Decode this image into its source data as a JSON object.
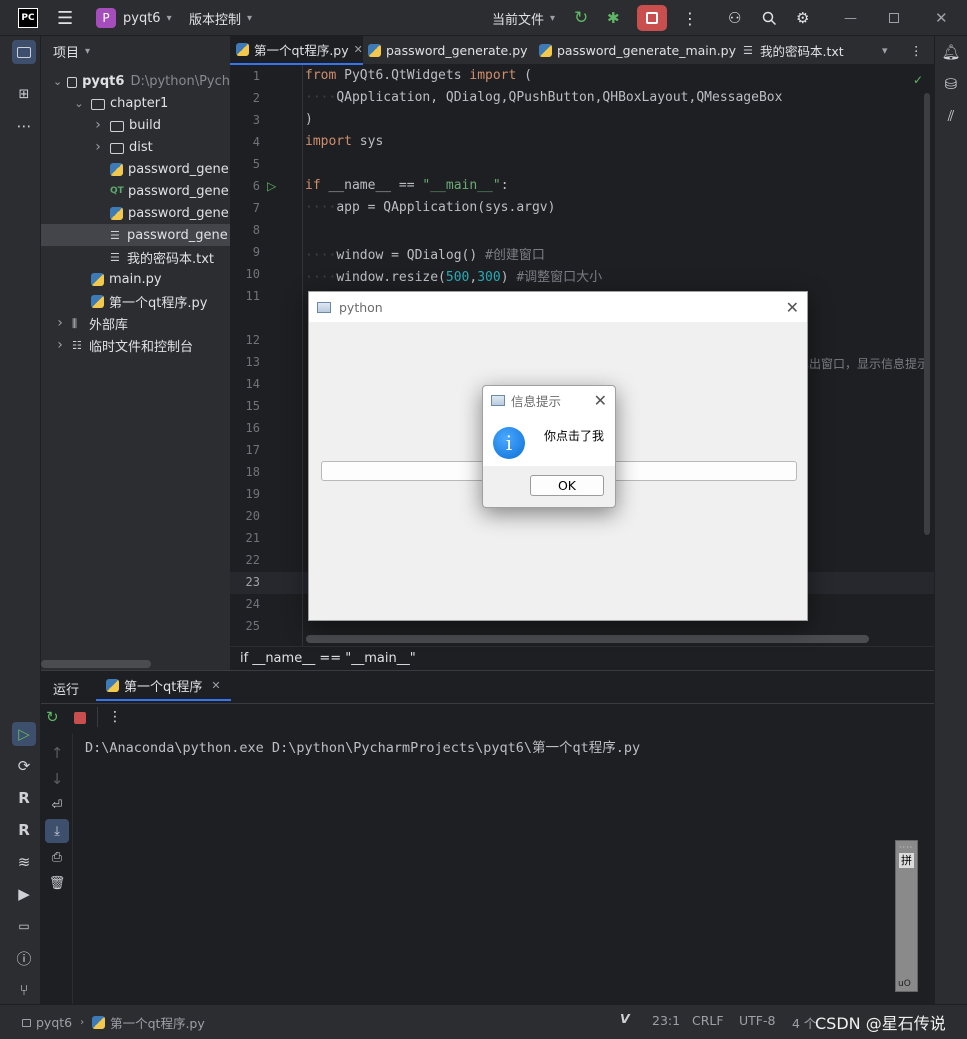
{
  "titlebar": {
    "app_badge": "PC",
    "project_badge": "P",
    "project_name": "pyqt6",
    "vcs_label": "版本控制",
    "run_config": "当前文件"
  },
  "project_panel": {
    "header": "项目",
    "tree": [
      {
        "label": "pyqt6",
        "hint": "D:\\python\\Pych",
        "kind": "folder",
        "depth": 0,
        "expanded": true
      },
      {
        "label": "chapter1",
        "kind": "folder",
        "depth": 1,
        "expanded": true
      },
      {
        "label": "build",
        "kind": "folder",
        "depth": 2,
        "expanded": false
      },
      {
        "label": "dist",
        "kind": "folder",
        "depth": 2,
        "expanded": false
      },
      {
        "label": "password_gene",
        "kind": "py",
        "depth": 2
      },
      {
        "label": "password_gene",
        "kind": "qt",
        "depth": 2
      },
      {
        "label": "password_gene",
        "kind": "py",
        "depth": 2
      },
      {
        "label": "password_gene",
        "kind": "txt",
        "depth": 2,
        "selected": true
      },
      {
        "label": "我的密码本.txt",
        "kind": "txt",
        "depth": 2
      },
      {
        "label": "main.py",
        "kind": "py",
        "depth": 1
      },
      {
        "label": "第一个qt程序.py",
        "kind": "py",
        "depth": 1
      },
      {
        "label": "外部库",
        "kind": "lib",
        "depth": 0,
        "expanded": false
      },
      {
        "label": "临时文件和控制台",
        "kind": "console",
        "depth": 0,
        "expanded": false
      }
    ]
  },
  "tabs": [
    {
      "label": "第一个qt程序.py",
      "active": true
    },
    {
      "label": "password_generate.py"
    },
    {
      "label": "password_generate_main.py"
    },
    {
      "label": "我的密码本.txt"
    }
  ],
  "editor": {
    "line_numbers": [
      "1",
      "2",
      "3",
      "4",
      "5",
      "6",
      "7",
      "8",
      "9",
      "10",
      "11",
      "12",
      "13",
      "14",
      "15",
      "16",
      "17",
      "18",
      "19",
      "20",
      "21",
      "22",
      "23",
      "24",
      "25"
    ],
    "code": {
      "l1_kw1": "from",
      "l1_mod": " PyQt6.QtWidgets ",
      "l1_kw2": "import",
      "l1_rest": " (",
      "l2": "QApplication, QDialog,QPushButton,QHBoxLayout,QMessageBox",
      "l3": ")",
      "l4_kw": "import",
      "l4_rest": " sys",
      "l6_kw": "if",
      "l6_mid": " __name__ == ",
      "l6_str": "\"__main__\"",
      "l6_end": ":",
      "l7": "app = QApplication(sys.argv)",
      "l9_code": "window = QDialog() ",
      "l9_cm": "#创建窗口",
      "l10_code": "window.resize(",
      "l10_n1": "500",
      "l10_comma": ",",
      "l10_n2": "300",
      "l10_close": ") ",
      "l10_cm": "#调整窗口大小",
      "l13_tail": "弹出窗口，显示信息提示"
    },
    "breadcrumb": "if __name__ == \"__main__\""
  },
  "dialog_python": {
    "title": "python"
  },
  "message_box": {
    "title": "信息提示",
    "text": "你点击了我",
    "ok_label": "OK",
    "info_glyph": "i"
  },
  "run_panel": {
    "tab_run": "运行",
    "tab_file": "第一个qt程序",
    "console_line": "D:\\Anaconda\\python.exe D:\\python\\PycharmProjects\\pyqt6\\第一个qt程序.py"
  },
  "ime": {
    "label": "拼",
    "footer": "uO"
  },
  "statusbar": {
    "project": "pyqt6",
    "file": "第一个qt程序.py",
    "position": "23:1",
    "line_sep": "CRLF",
    "encoding": "UTF-8",
    "indent": "4 个",
    "watermark": "CSDN @星石传说"
  },
  "colors": {
    "accent": "#3574f0",
    "stop_button": "#c94f4f",
    "run_green": "#5fb865"
  }
}
